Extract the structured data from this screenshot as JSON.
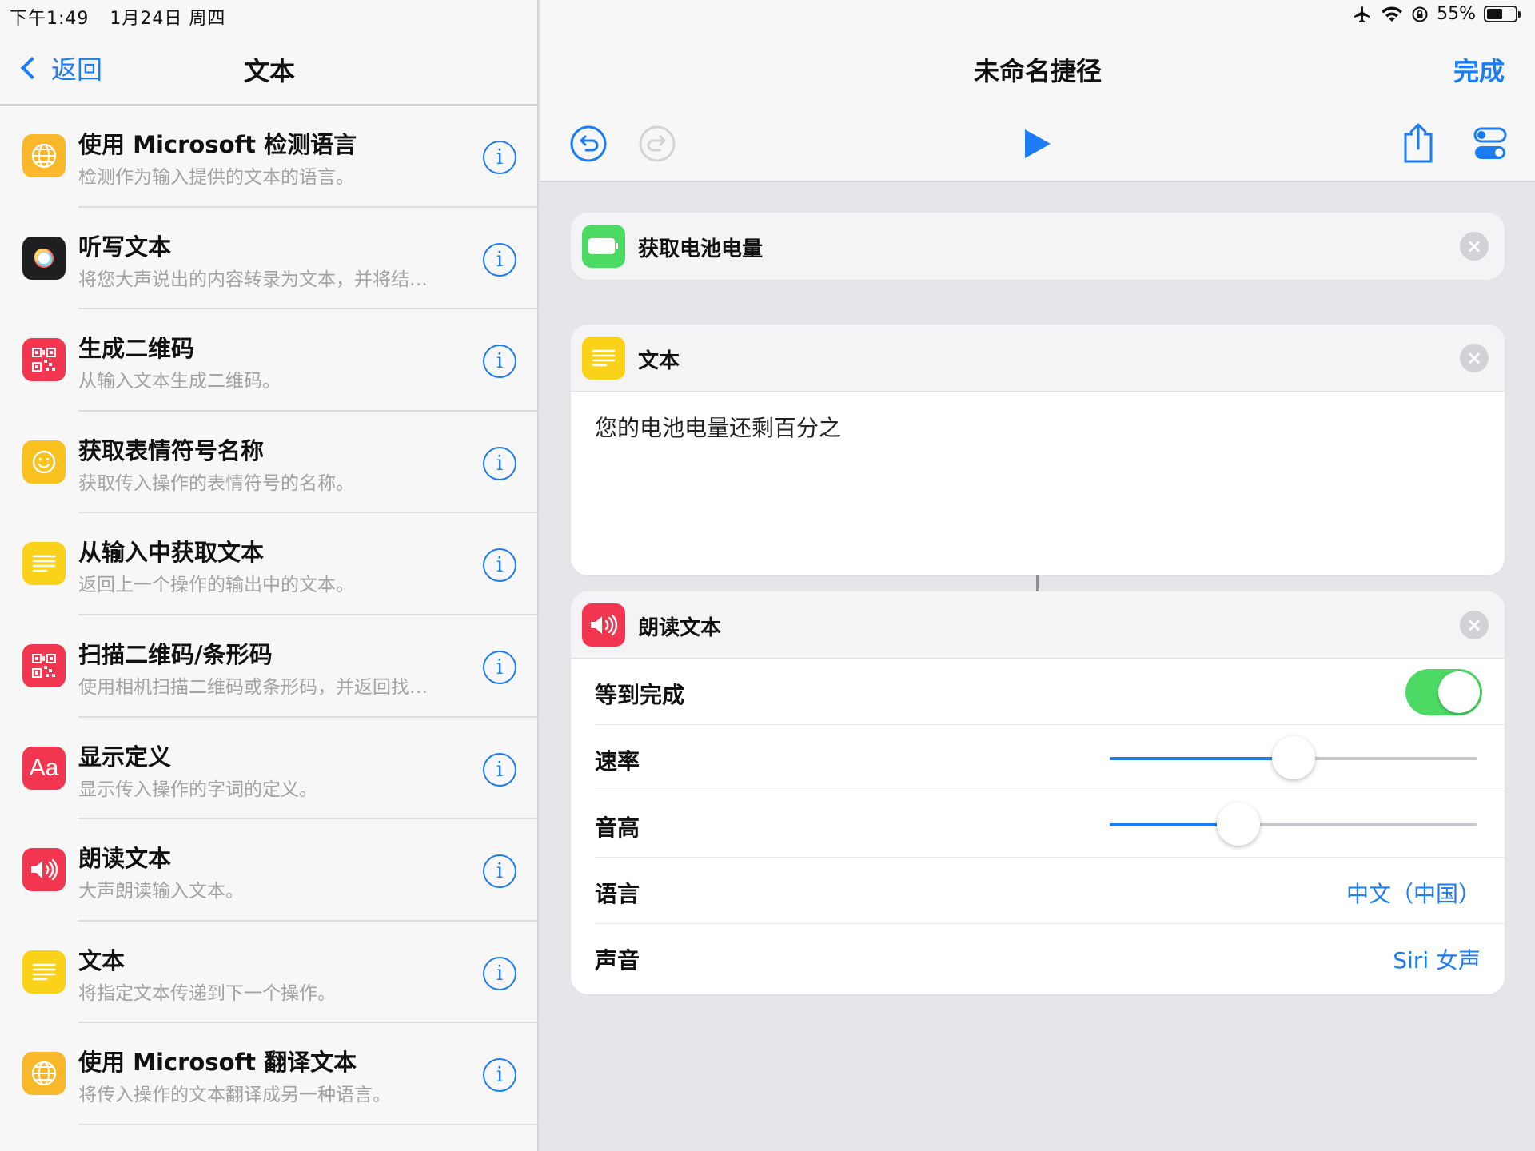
{
  "status_bar": {
    "time": "下午1:49",
    "date": "1月24日 周四",
    "battery": "55%",
    "battery_level": 0.55
  },
  "left": {
    "back_label": "返回",
    "title": "文本",
    "actions": [
      {
        "title": "使用 Microsoft 检测语言",
        "desc": "检测作为输入提供的文本的语言。",
        "icon": "globe-icon",
        "color": "#f8b82a"
      },
      {
        "title": "听写文本",
        "desc": "将您大声说出的内容转录为文本，并将结…",
        "icon": "dictation-icon",
        "color": "#1f1f22"
      },
      {
        "title": "生成二维码",
        "desc": "从输入文本生成二维码。",
        "icon": "qr-code-icon",
        "color": "#f2364f"
      },
      {
        "title": "获取表情符号名称",
        "desc": "获取传入操作的表情符号的名称。",
        "icon": "smiley-icon",
        "color": "#f9c21e"
      },
      {
        "title": "从输入中获取文本",
        "desc": "返回上一个操作的输出中的文本。",
        "icon": "text-lines-icon",
        "color": "#fbd21a"
      },
      {
        "title": "扫描二维码/条形码",
        "desc": "使用相机扫描二维码或条形码，并返回找…",
        "icon": "qr-code-icon",
        "color": "#f2364f"
      },
      {
        "title": "显示定义",
        "desc": "显示传入操作的字词的定义。",
        "icon": "dictionary-icon",
        "color": "#f2364f"
      },
      {
        "title": "朗读文本",
        "desc": "大声朗读输入文本。",
        "icon": "speaker-icon",
        "color": "#f2364f"
      },
      {
        "title": "文本",
        "desc": "将指定文本传递到下一个操作。",
        "icon": "text-lines-icon",
        "color": "#fbd21a"
      },
      {
        "title": "使用 Microsoft 翻译文本",
        "desc": "将传入操作的文本翻译成另一种语言。",
        "icon": "globe-icon",
        "color": "#f8b82a"
      }
    ],
    "dictionary_glyph": "Aa"
  },
  "right": {
    "title": "未命名捷径",
    "done_label": "完成",
    "cards": {
      "battery": {
        "title": "获取电池电量"
      },
      "text": {
        "title": "文本",
        "content": "您的电池电量还剩百分之"
      },
      "speak": {
        "title": "朗读文本",
        "wait_label": "等到完成",
        "wait_on": true,
        "rate_label": "速率",
        "rate_value": 0.5,
        "pitch_label": "音高",
        "pitch_value": 0.35,
        "language_label": "语言",
        "language_value": "中文（中国）",
        "voice_label": "声音",
        "voice_value": "Siri 女声"
      }
    }
  },
  "colors": {
    "accent": "#1c7cf4",
    "toggle_on": "#4cd964",
    "battery_green": "#4cd964",
    "text_yellow": "#fbd21a",
    "speak_red": "#f2364f"
  }
}
